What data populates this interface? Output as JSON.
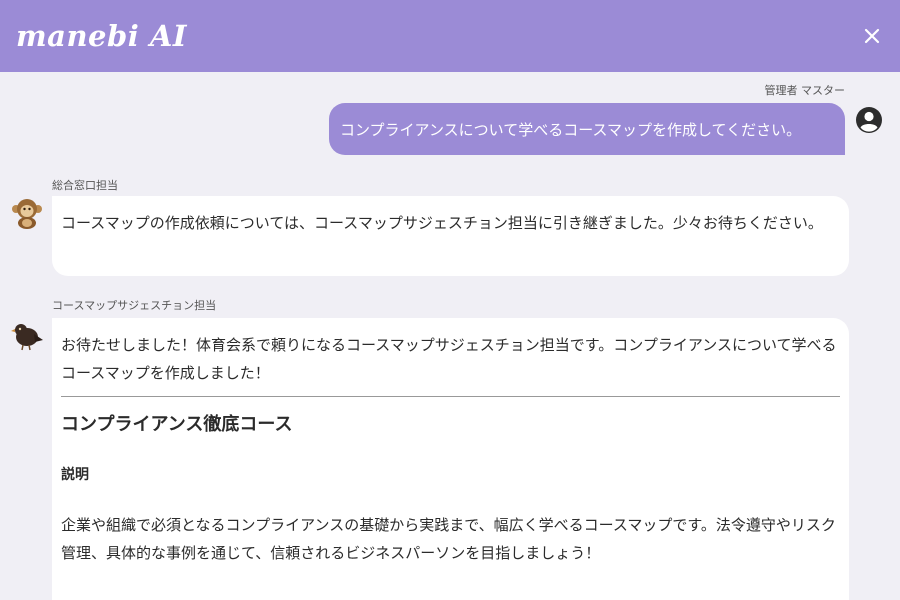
{
  "header": {
    "logo_text": "manebi AI",
    "brand_color": "#9b8bd6"
  },
  "icons": {
    "close": "close-icon",
    "user_avatar": "account-circle-icon",
    "agent1_avatar": "monkey-icon",
    "agent2_avatar": "crow-icon"
  },
  "user_message": {
    "sender": "管理者 マスター",
    "text": "コンプライアンスについて学べるコースマップを作成してください。"
  },
  "agent_messages": [
    {
      "sender": "総合窓口担当",
      "text": "コースマップの作成依頼については、コースマップサジェスチョン担当に引き継ぎました。少々お待ちください。"
    },
    {
      "sender": "コースマップサジェスチョン担当",
      "intro": "お待たせしました！体育会系で頼りになるコースマップサジェスチョン担当です。コンプライアンスについて学べるコースマップを作成しました！",
      "course_title": "コンプライアンス徹底コース",
      "section_label": "説明",
      "description": "企業や組織で必須となるコンプライアンスの基礎から実践まで、幅広く学べるコースマップです。法令遵守やリスク管理、具体的な事例を通じて、信頼されるビジネスパーソンを目指しましょう！"
    }
  ]
}
